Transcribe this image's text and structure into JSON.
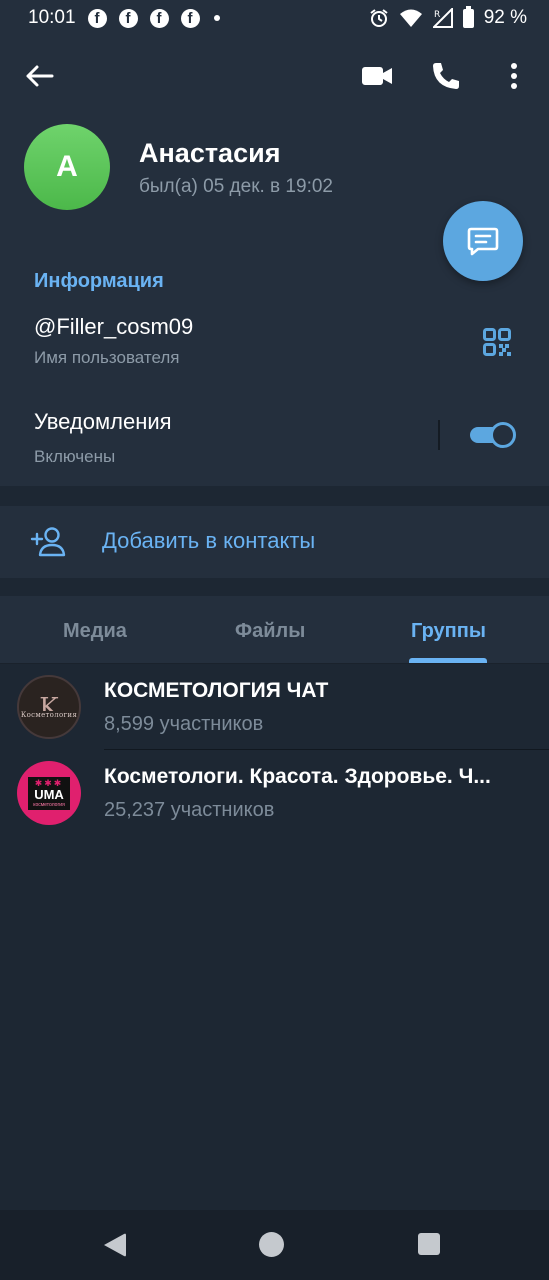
{
  "status_bar": {
    "time": "10:01",
    "notification_icons": [
      "facebook-icon",
      "facebook-icon",
      "facebook-icon",
      "facebook-icon"
    ],
    "battery": "92 %",
    "right_icons": [
      "alarm-icon",
      "wifi-icon",
      "signal-icon",
      "battery-icon"
    ]
  },
  "header": {
    "name": "Анастасия",
    "last_seen": "был(а) 05 дек. в 19:02",
    "avatar_letter": "А",
    "actions": [
      "back-arrow-icon",
      "video-call-icon",
      "phone-icon",
      "more-vertical-icon"
    ]
  },
  "info": {
    "title": "Информация",
    "username": "@Filler_cosm09",
    "username_label": "Имя пользователя",
    "notifications_label": "Уведомления",
    "notifications_status": "Включены",
    "notifications_enabled": true
  },
  "add_contact": {
    "label": "Добавить в контакты"
  },
  "tabs": {
    "items": [
      {
        "label": "Медиа",
        "active": false
      },
      {
        "label": "Файлы",
        "active": false
      },
      {
        "label": "Группы",
        "active": true
      }
    ]
  },
  "groups": [
    {
      "name": "КОСМЕТОЛОГИЯ ЧАТ",
      "members": "8,599 участников",
      "avatar_letter": "K",
      "avatar_caption": "Косметология"
    },
    {
      "name": "Косметологи. Красота. Здоровье. Ч...",
      "members": "25,237 участников",
      "avatar_text": "UMA",
      "avatar_caption": "косметология"
    }
  ],
  "colors": {
    "background": "#1d2733",
    "surface": "#242f3d",
    "accent": "#6ab3f3",
    "fab": "#5ca7e0",
    "secondary_text": "#8d9ba8",
    "avatar_green": "#5bc558"
  }
}
